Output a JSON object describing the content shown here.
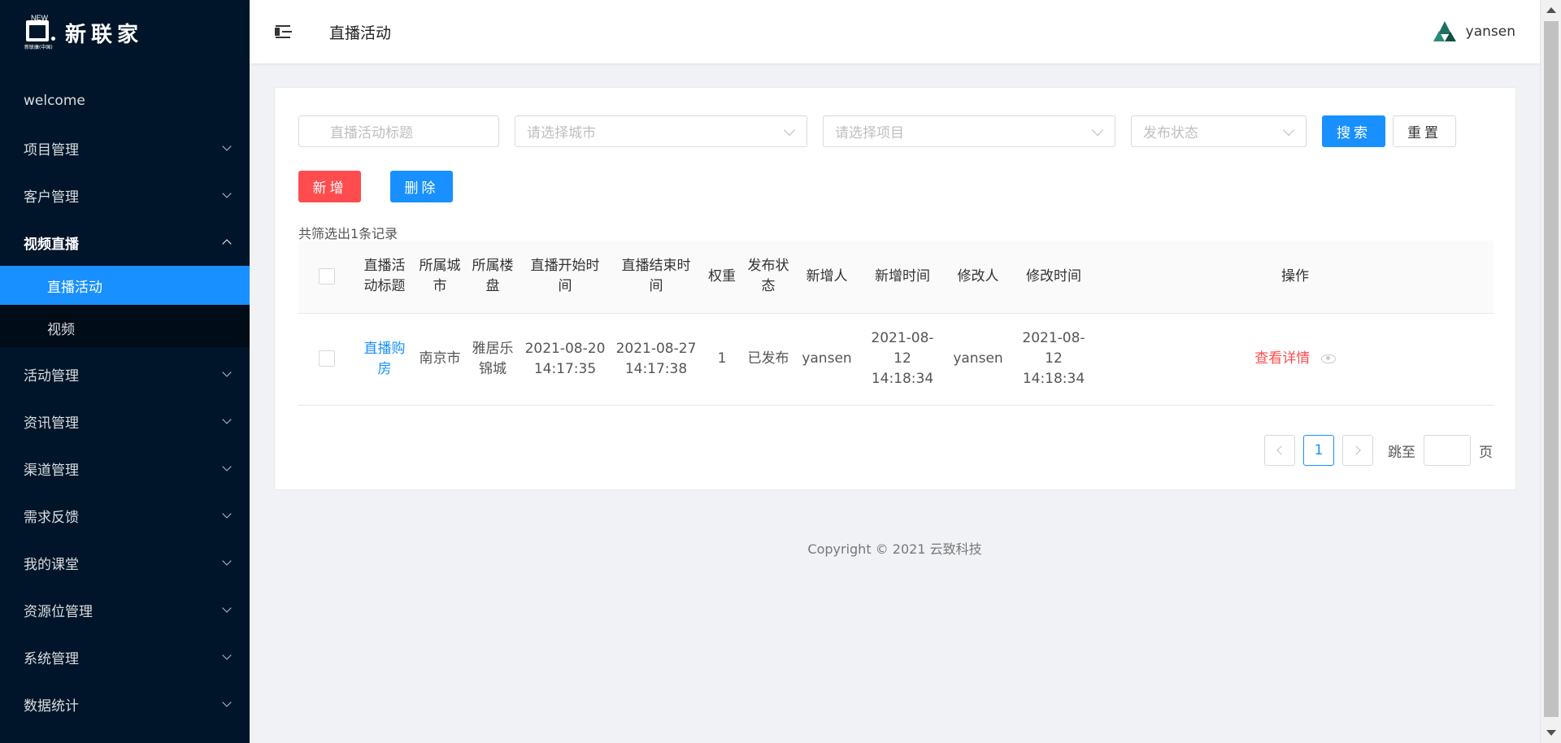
{
  "brand": {
    "name": "新联家",
    "mark_top": "NEW",
    "mark_sub": "新联康(中国)"
  },
  "sidebar": {
    "items": [
      {
        "label": "welcome",
        "has_children": false
      },
      {
        "label": "项目管理",
        "has_children": true
      },
      {
        "label": "客户管理",
        "has_children": true
      },
      {
        "label": "视频直播",
        "has_children": true,
        "open": true,
        "children": [
          {
            "label": "直播活动",
            "active": true
          },
          {
            "label": "视频",
            "active": false
          }
        ]
      },
      {
        "label": "活动管理",
        "has_children": true
      },
      {
        "label": "资讯管理",
        "has_children": true
      },
      {
        "label": "渠道管理",
        "has_children": true
      },
      {
        "label": "需求反馈",
        "has_children": true
      },
      {
        "label": "我的课堂",
        "has_children": true
      },
      {
        "label": "资源位管理",
        "has_children": true
      },
      {
        "label": "系统管理",
        "has_children": true
      },
      {
        "label": "数据统计",
        "has_children": true
      }
    ]
  },
  "header": {
    "title": "直播活动",
    "username": "yansen"
  },
  "filters": {
    "title_placeholder": "直播活动标题",
    "city_placeholder": "请选择城市",
    "project_placeholder": "请选择项目",
    "status_placeholder": "发布状态",
    "search_label": "搜索",
    "reset_label": "重置"
  },
  "actions": {
    "add_label": "新增",
    "delete_label": "删除"
  },
  "summary": "共筛选出1条记录",
  "table": {
    "columns": [
      "直播活动标题",
      "所属城市",
      "所属楼盘",
      "直播开始时间",
      "直播结束时间",
      "权重",
      "发布状态",
      "新增人",
      "新增时间",
      "修改人",
      "修改时间",
      "操作"
    ],
    "rows": [
      {
        "title": "直播购房",
        "city": "南京市",
        "estate": "雅居乐锦城",
        "start": "2021-08-20 14:17:35",
        "end": "2021-08-27 14:17:38",
        "weight": "1",
        "status": "已发布",
        "creator": "yansen",
        "created": "2021-08-12 14:18:34",
        "modifier": "yansen",
        "modified": "2021-08-12 14:18:34",
        "op": "查看详情"
      }
    ]
  },
  "pagination": {
    "current": "1",
    "jump_label": "跳至",
    "page_label": "页"
  },
  "footer": "Copyright © 2021 云致科技",
  "colors": {
    "sidebar": "#001529",
    "primary": "#1890ff",
    "danger": "#ff4d4f"
  }
}
